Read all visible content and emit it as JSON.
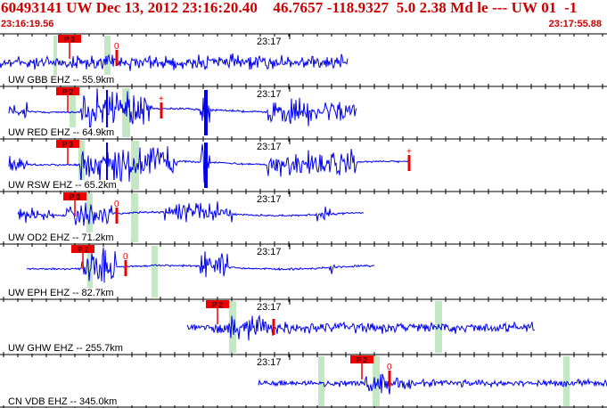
{
  "header": {
    "title": "60493141 UW Dec 13, 2012 23:16:20.40    46.7657 -118.9327  5.0 2.38 Md le --- UW 01  -1",
    "start_time": "23:16:19.56",
    "end_time": "23:17:55.88"
  },
  "time_label": "23:17",
  "colors": {
    "trace": "#0000ee",
    "pick": "#ee0000",
    "window": "#b8e4b8",
    "grid": "#000000",
    "label_bg": "#ffffff"
  },
  "stations": [
    {
      "label": "UW GBB EHZ -- 55.9km",
      "pick_label": "P 3",
      "marker": "0",
      "marker_type": "amp-circle"
    },
    {
      "label": "UW RED EHZ -- 64.9km",
      "pick_label": "P 2",
      "marker": "+",
      "marker_type": "amp-plus"
    },
    {
      "label": "UW RSW EHZ -- 65.2km",
      "pick_label": "P 3",
      "marker": "+",
      "marker_type": "amp-plus"
    },
    {
      "label": "UW OD2 EHZ -- 71.2km",
      "pick_label": "P 3",
      "marker": "0",
      "marker_type": "amp-circle"
    },
    {
      "label": "UW EPH EHZ -- 82.7km",
      "pick_label": "P 2",
      "marker": "0",
      "marker_type": "amp-circle"
    },
    {
      "label": "UW GHW EHZ -- 255.7km",
      "pick_label": "P 2",
      "marker": "",
      "marker_type": "none"
    },
    {
      "label": "CN VDB EHZ -- 345.0km",
      "pick_label": "P 2",
      "marker": "0",
      "marker_type": "amp-circle"
    }
  ]
}
